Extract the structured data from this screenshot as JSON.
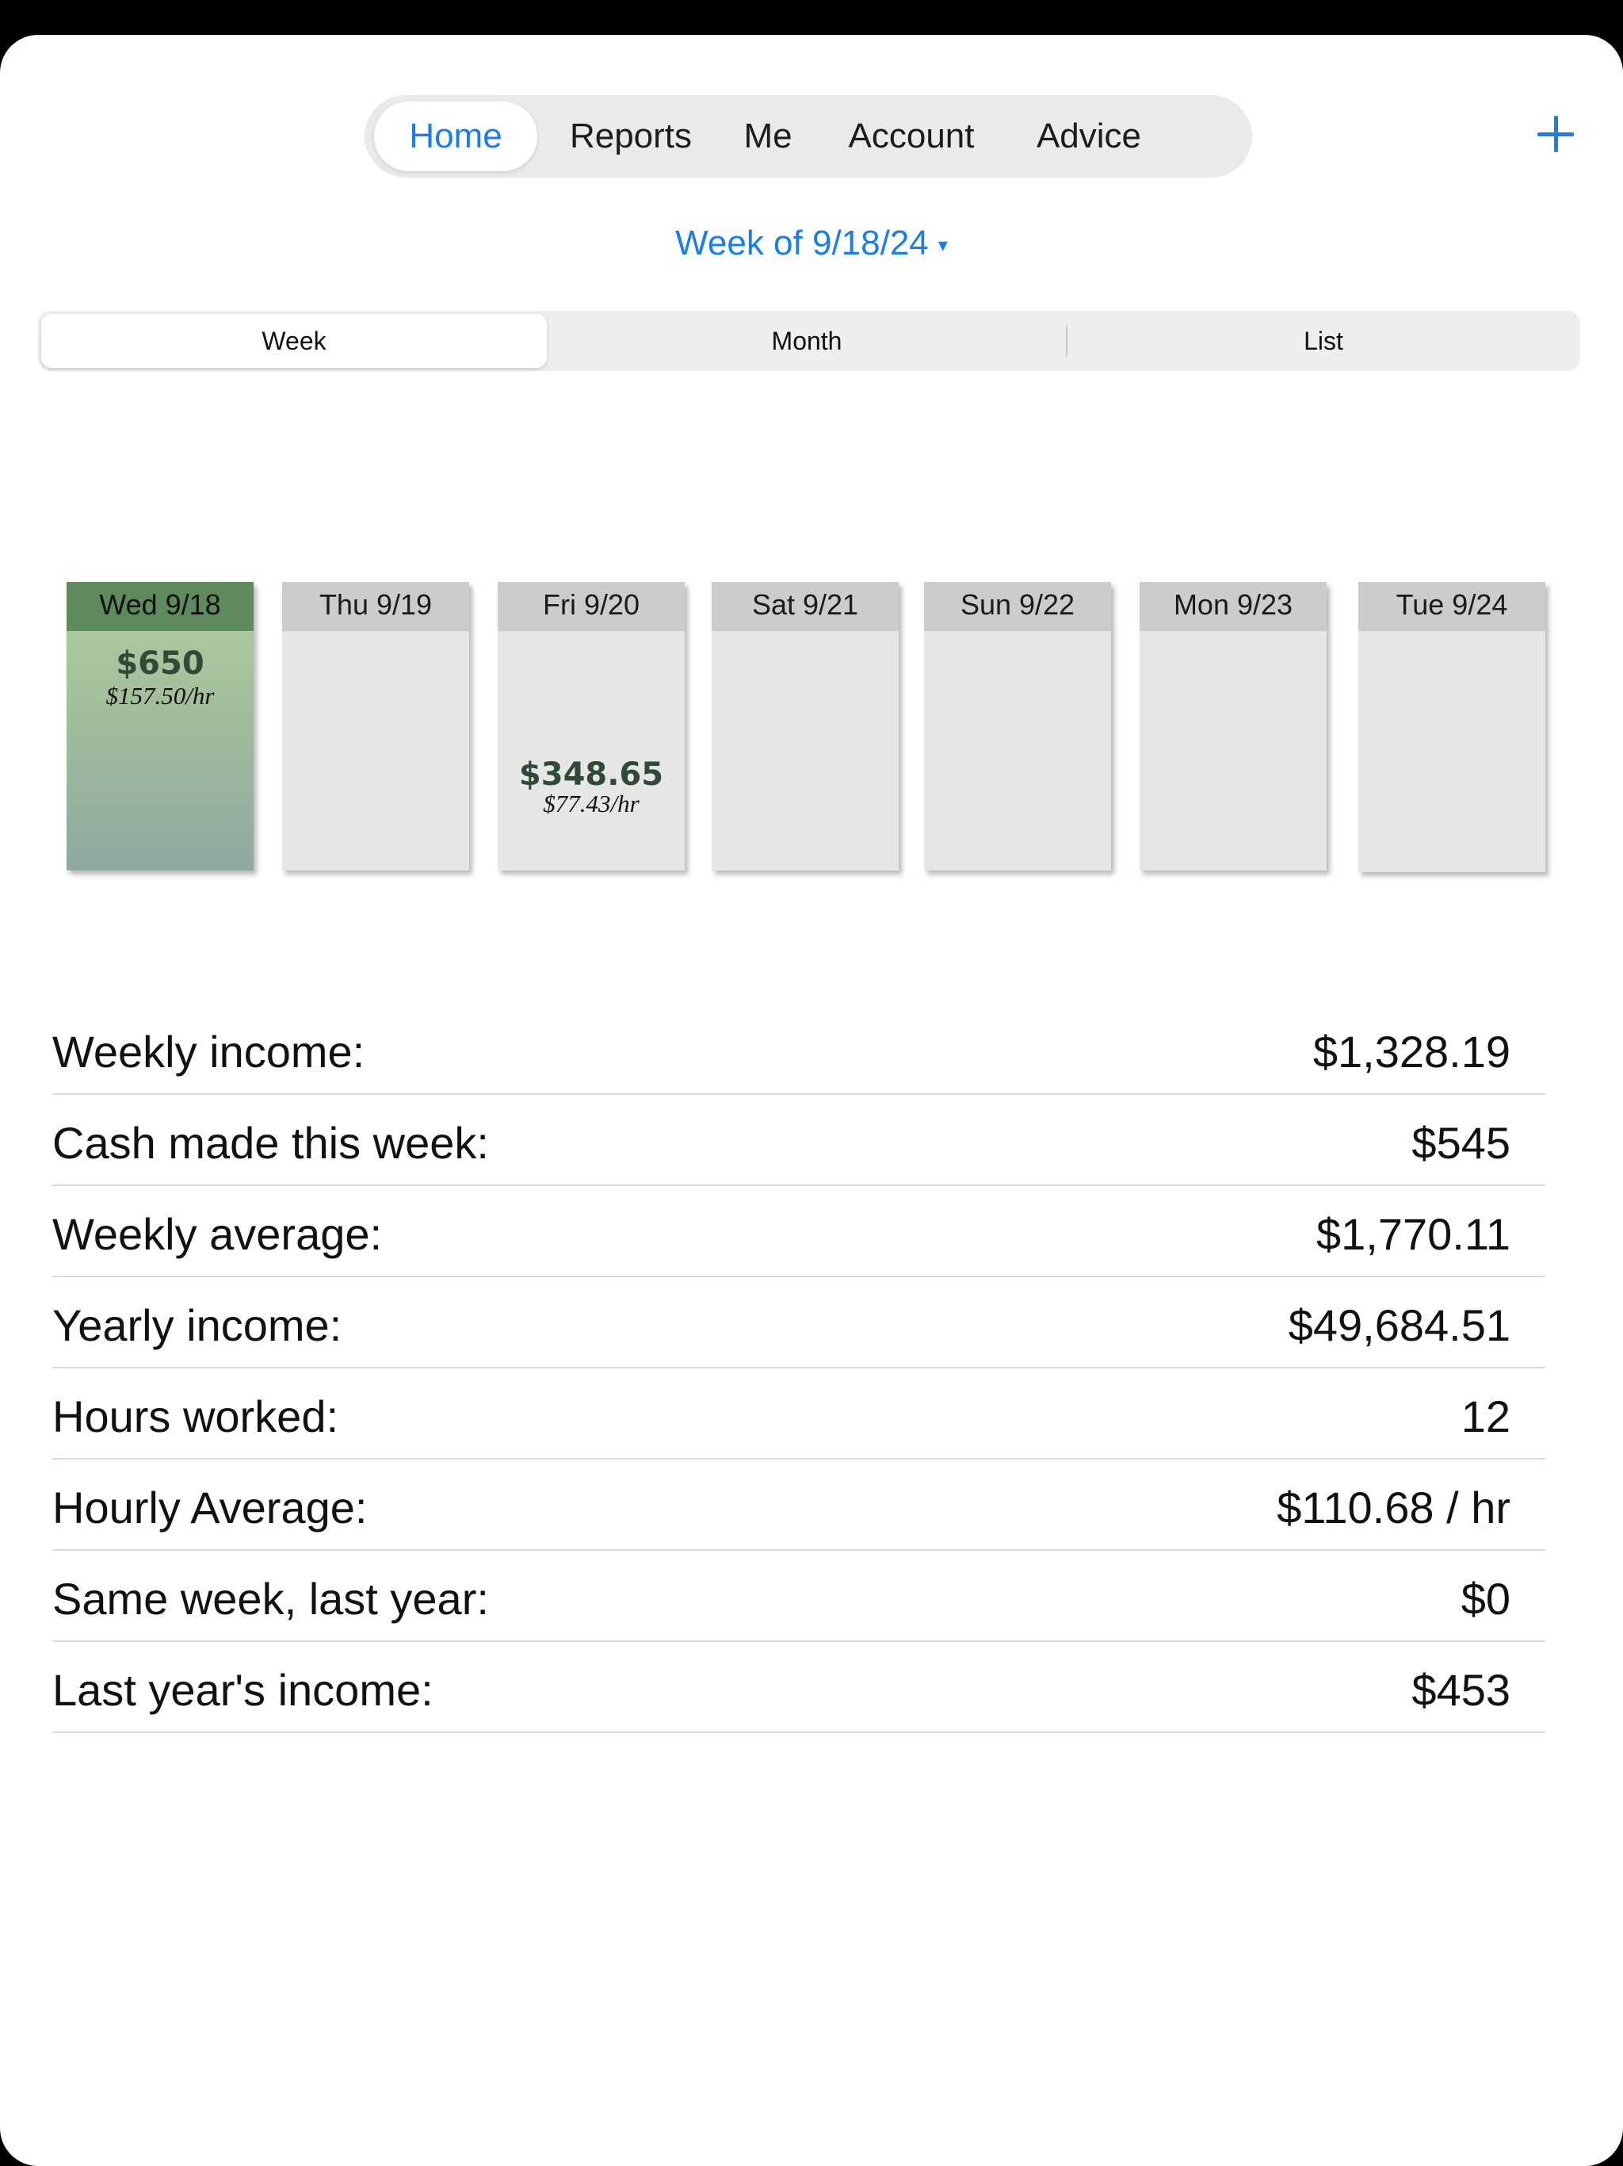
{
  "tabs": [
    {
      "label": "Home",
      "active": true
    },
    {
      "label": "Reports",
      "active": false
    },
    {
      "label": "Me",
      "active": false
    },
    {
      "label": "Account",
      "active": false
    },
    {
      "label": "Advice",
      "active": false
    }
  ],
  "week_picker": {
    "label": "Week of 9/18/24",
    "caret": "▾"
  },
  "view_segments": [
    {
      "label": "Week",
      "active": true
    },
    {
      "label": "Month",
      "active": false
    },
    {
      "label": "List",
      "active": false
    }
  ],
  "days": [
    {
      "label": "Wed 9/18",
      "amount": "$650",
      "rate": "$157.50/hr",
      "highlight": true
    },
    {
      "label": "Thu 9/19",
      "amount": "",
      "rate": "",
      "highlight": false
    },
    {
      "label": "Fri 9/20",
      "amount": "$348.65",
      "rate": "$77.43/hr",
      "highlight": false
    },
    {
      "label": "Sat 9/21",
      "amount": "",
      "rate": "",
      "highlight": false
    },
    {
      "label": "Sun 9/22",
      "amount": "",
      "rate": "",
      "highlight": false
    },
    {
      "label": "Mon 9/23",
      "amount": "",
      "rate": "",
      "highlight": false
    },
    {
      "label": "Tue 9/24",
      "amount": "",
      "rate": "",
      "highlight": false
    }
  ],
  "stats": [
    {
      "label": "Weekly income:",
      "value": "$1,328.19"
    },
    {
      "label": "Cash made this week:",
      "value": "$545"
    },
    {
      "label": "Weekly average:",
      "value": "$1,770.11"
    },
    {
      "label": "Yearly income:",
      "value": "$49,684.51"
    },
    {
      "label": "Hours worked:",
      "value": "12"
    },
    {
      "label": "Hourly Average:",
      "value": "$110.68 / hr"
    },
    {
      "label": "Same week, last year:",
      "value": "$0"
    },
    {
      "label": "Last year's income:",
      "value": "$453"
    }
  ],
  "colors": {
    "accent": "#1a7ee6",
    "highlight_header": "#5e8a5d",
    "amount_text": "#2f4a37"
  }
}
